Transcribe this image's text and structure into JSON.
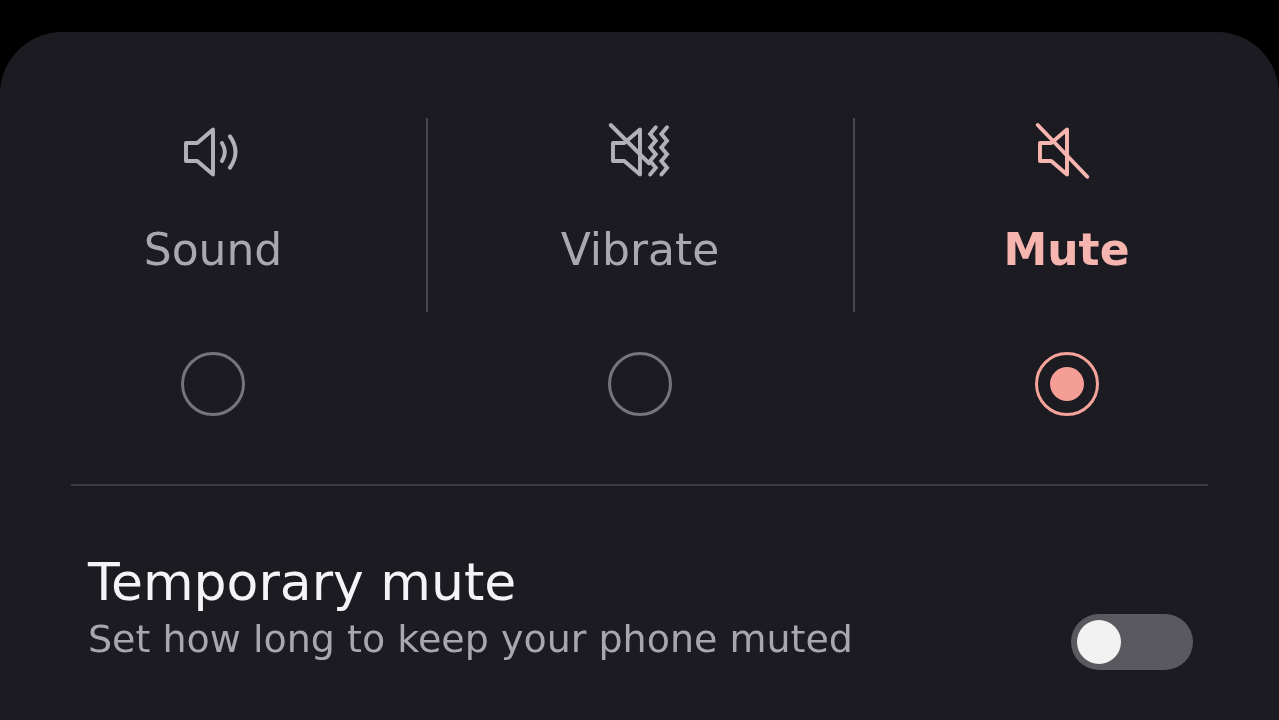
{
  "modes": [
    {
      "kind": "sound",
      "label": "Sound",
      "selected": false
    },
    {
      "kind": "vibrate",
      "label": "Vibrate",
      "selected": false
    },
    {
      "kind": "mute",
      "label": "Mute",
      "selected": true
    }
  ],
  "temporary_mute": {
    "title": "Temporary mute",
    "description": "Set how long to keep your phone muted",
    "on": false
  }
}
